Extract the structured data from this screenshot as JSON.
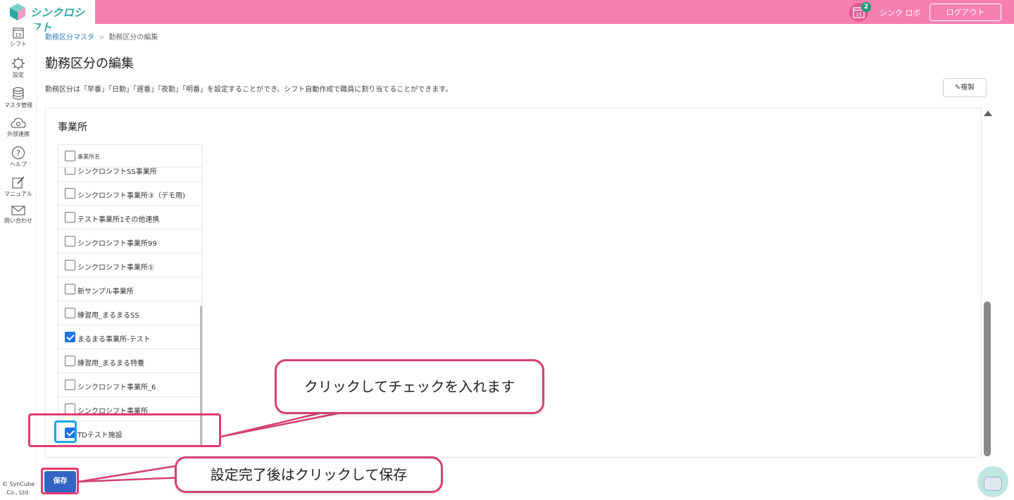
{
  "header": {
    "logo_text": "シンクロシフト",
    "calendar_icon_day": "15",
    "notification_count": "2",
    "user_name": "シンク ロボ",
    "logout_label": "ログアウト",
    "bg_color": "#f77fb0"
  },
  "sidenav": {
    "items": [
      {
        "icon": "calendar-icon",
        "day": "15",
        "label": "シフト"
      },
      {
        "icon": "gear-icon",
        "label": "設定"
      },
      {
        "icon": "database-icon",
        "label": "マスタ管理"
      },
      {
        "icon": "cloud-icon",
        "label": "外部連携"
      },
      {
        "icon": "help-icon",
        "label": "ヘルプ"
      },
      {
        "icon": "manual-icon",
        "label": "マニュアル"
      },
      {
        "icon": "mail-icon",
        "label": "問い合わせ"
      }
    ],
    "copyright_line1": "© SynCube",
    "copyright_line2": "Co., Ltd."
  },
  "breadcrumb": {
    "parent": "勤務区分マスタ",
    "separator": ">",
    "current": "勤務区分の編集"
  },
  "page": {
    "title": "勤務区分の編集",
    "description": "勤務区分は「早番」「日勤」「遅番」「夜勤」「明番」を設定することができ、シフト自動作成で職員に割り当てることができます。",
    "copy_button": "複製"
  },
  "offices": {
    "section_title": "事業所",
    "header_label": "事業所名",
    "rows": [
      {
        "label": "シンクロシフトSS事業所",
        "checked": false
      },
      {
        "label": "シンクロシフト事業所③（デモ用)",
        "checked": false
      },
      {
        "label": "テスト事業所1その他連携",
        "checked": false
      },
      {
        "label": "シンクロシフト事業所99",
        "checked": false
      },
      {
        "label": "シンクロシフト事業所①",
        "checked": false
      },
      {
        "label": "新サンプル事業所",
        "checked": false
      },
      {
        "label": "練習用_まるまるSS",
        "checked": false
      },
      {
        "label": "まるまる事業所-テスト",
        "checked": true
      },
      {
        "label": "練習用_まるまる特養",
        "checked": false
      },
      {
        "label": "シンクロシフト事業所_6",
        "checked": false
      },
      {
        "label": "シンクロシフト事業所",
        "checked": false
      },
      {
        "label": "TDテスト施設",
        "checked": true
      }
    ]
  },
  "save_button": "保存",
  "annotations": {
    "callout_check": "クリックしてチェックを入れます",
    "callout_save": "設定完了後はクリックして保存",
    "highlight_color": "#e33a72",
    "checkbox_highlight_color": "#1aa8e0"
  }
}
